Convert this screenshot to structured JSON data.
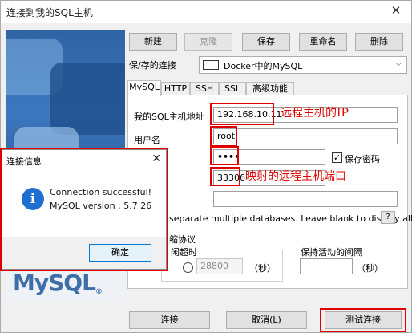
{
  "window": {
    "title": "连接到我的SQL主机"
  },
  "toolbar": {
    "new_label": "新建",
    "clone_label": "克隆",
    "save_label": "保存",
    "rename_label": "重命名",
    "delete_label": "删除"
  },
  "saved_connection": {
    "label": "保/存的连接",
    "value": "Docker中的MySQL"
  },
  "tabs": [
    {
      "label": "MySQL",
      "active": true
    },
    {
      "label": "HTTP"
    },
    {
      "label": "SSH"
    },
    {
      "label": "SSL"
    },
    {
      "label": "高级功能"
    }
  ],
  "form": {
    "host_label": "我的SQL主机地址",
    "host_value": "192.168.10.11",
    "user_label": "用户名",
    "user_value": "root",
    "password_value": "••••",
    "save_password_label": "保存密码",
    "save_password_checked": true,
    "port_value": "33306",
    "databases_hint": "separate multiple databases. Leave blank to display all)",
    "help_label": "?",
    "compress_label": "缩协议",
    "timeout_label": "闲超时",
    "timeout_value": "28800",
    "timeout_unit": "（秒）",
    "keepalive_label": "保持活动的间隔",
    "keepalive_unit": "（秒）"
  },
  "annotations": {
    "remote_ip": "远程主机的IP",
    "mapped_port": "映射的远程主机端口"
  },
  "bottom_buttons": {
    "connect_label": "连接",
    "cancel_label": "取消(L)",
    "test_label": "测试连接"
  },
  "logo": {
    "text": "MySQL",
    "mark": "®"
  },
  "popup": {
    "title": "连接信息",
    "icon": "info-icon",
    "message_line1": "Connection successful!",
    "message_line2": "MySQL version : 5.7.26",
    "ok_label": "确定"
  },
  "colors": {
    "annotation_red": "#e00000",
    "info_blue": "#1e6fd0",
    "logo_blue": "#3f6fa8"
  }
}
